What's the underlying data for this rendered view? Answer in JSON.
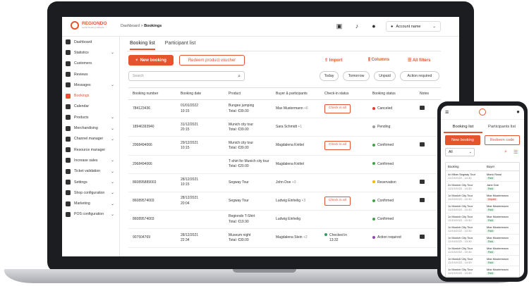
{
  "app": {
    "brand": "REGIONDO",
    "brand_sub": "tourist booking software"
  },
  "topbar": {
    "breadcrumb_parent": "Dashboard",
    "breadcrumb_sep": ">",
    "breadcrumb_current": "Bookings",
    "account_label": "Account name"
  },
  "sidebar": {
    "items": [
      {
        "label": "Dashboard",
        "icon": "grid-icon",
        "chevron": false
      },
      {
        "label": "Statistics",
        "icon": "chart-icon",
        "chevron": true
      },
      {
        "label": "Customers",
        "icon": "people-icon",
        "chevron": false
      },
      {
        "label": "Reviews",
        "icon": "star-icon",
        "chevron": false
      },
      {
        "label": "Messages",
        "icon": "mail-icon",
        "chevron": true
      },
      {
        "label": "Bookings",
        "icon": "ticket-icon",
        "chevron": false,
        "active": true
      },
      {
        "label": "Calendar",
        "icon": "calendar-icon",
        "chevron": false
      },
      {
        "label": "Products",
        "icon": "tag-icon",
        "chevron": true
      },
      {
        "label": "Merchandising",
        "icon": "bag-icon",
        "chevron": true
      },
      {
        "label": "Channel manager",
        "icon": "channel-icon",
        "chevron": true
      },
      {
        "label": "Resource manager",
        "icon": "resource-icon",
        "chevron": false
      },
      {
        "label": "Increase sales",
        "icon": "trend-icon",
        "chevron": true
      },
      {
        "label": "Ticket validation",
        "icon": "ticket-check-icon",
        "chevron": true
      },
      {
        "label": "Settings",
        "icon": "gear-icon",
        "chevron": true
      },
      {
        "label": "Shop configuration",
        "icon": "shop-icon",
        "chevron": true
      },
      {
        "label": "Marketing",
        "icon": "megaphone-icon",
        "chevron": true
      },
      {
        "label": "POS configuration",
        "icon": "pos-icon",
        "chevron": true
      }
    ]
  },
  "main": {
    "tabs": [
      "Booking list",
      "Participant list"
    ],
    "new_booking": "New booking",
    "redeem_voucher": "Redeem product voucher",
    "import": "Import",
    "columns": "Columns",
    "all_filters": "All filters",
    "search_placeholder": "Search",
    "filters": [
      "Today",
      "Tomorrow",
      "Unpaid",
      "Action required"
    ],
    "columns_headers": [
      "Booking number",
      "Booking date",
      "Product",
      "Buyer & participants",
      "Check-in status",
      "Booking status",
      "Notes"
    ],
    "rows": [
      {
        "num": "784123436",
        "date": "01/01/2022",
        "time": "10:15",
        "product": "Bungee jumping",
        "total": "Total: €39.00",
        "buyer": "Max Mustermann",
        "extra": "+6",
        "checkin": "Check in all",
        "status": "Canceled",
        "status_color": "#e53935",
        "note": true
      },
      {
        "num": "18946393940",
        "date": "31/12/2021",
        "time": "20:15",
        "product": "Munich city tour",
        "total": "Total: €39.00",
        "buyer": "Sara Schmidt",
        "extra": "+1",
        "checkin": "",
        "status": "Pending",
        "status_color": "#9e9e9e",
        "note": false
      },
      {
        "num": "2068494066",
        "date": "29/12/2021",
        "time": "10:15",
        "product": "Munich city tour",
        "total": "Total: €39.00",
        "buyer": "Magdalena Knittel",
        "extra": "",
        "checkin": "Check in all",
        "status": "Confirmed",
        "status_color": "#43a047",
        "note": true
      },
      {
        "num": "2068494066",
        "date": "",
        "time": "",
        "product": "T-shirt for Munich city tour",
        "total": "Total: €20.00",
        "buyer": "Magdalena Knittel",
        "extra": "",
        "checkin": "",
        "status": "Confirmed",
        "status_color": "#43a047",
        "note": false
      },
      {
        "num": "860895889003",
        "date": "28/12/2021",
        "time": "10:15",
        "product": "Segway Tour",
        "total": "",
        "buyer": "John Doe",
        "extra": "+3",
        "checkin": "",
        "status": "Reservation",
        "status_color": "#f2b705",
        "note": true
      },
      {
        "num": "86089574003",
        "date": "28/12/2021",
        "time": "20:04",
        "product": "Segway Tour",
        "total": "",
        "buyer": "Ludwig Einhelig",
        "extra": "+3",
        "checkin": "Check in all",
        "status": "Confirmed",
        "status_color": "#43a047",
        "note": true
      },
      {
        "num": "86089574003",
        "date": "",
        "time": "",
        "product": "Regiondo T-Shirt",
        "total": "Total: €19.90",
        "buyer": "Ludwig Einhelig",
        "extra": "",
        "checkin": "",
        "status": "Confirmed",
        "status_color": "#43a047",
        "note": false
      },
      {
        "num": "907504769",
        "date": "28/12/2021",
        "time": "22:34",
        "product": "Museum night",
        "total": "Total: €39.00",
        "buyer": "Magdalena Stein",
        "extra": "+2",
        "checkin": "Checked in",
        "checkin_time": "13:32",
        "status": "Action required",
        "status_color": "#8e44ad",
        "note": true
      }
    ]
  },
  "phone": {
    "tabs": [
      "Booking list",
      "Participants list"
    ],
    "new_booking": "New booking",
    "redeem_code": "Redeem code",
    "select_value": "All",
    "headers": [
      "Booking",
      "Buyer"
    ],
    "rows": [
      {
        "booking": "4x Milan Segway Tour",
        "date": "12/10/2022 - 10:30",
        "buyer": "Mario Rossi",
        "pay": "Paid"
      },
      {
        "booking": "2x Munich City Tour",
        "date": "12/10/2022 - 10:30",
        "buyer": "Jane Doe",
        "pay": "Paid"
      },
      {
        "booking": "1x Munich City Tour",
        "date": "12/10/2022 - 10:30",
        "buyer": "Max Mustermann",
        "pay": "Unpaid"
      },
      {
        "booking": "1x Munich City Tour",
        "date": "12/10/2022 - 10:30",
        "buyer": "Max Mustermann",
        "pay": "Paid"
      },
      {
        "booking": "1x Munich City Tour",
        "date": "12/10/2022 - 10:30",
        "buyer": "Max Mustermann",
        "pay": "Paid"
      },
      {
        "booking": "1x Munich City Tour",
        "date": "12/10/2022 - 10:30",
        "buyer": "Max Mustermann",
        "pay": "Paid"
      },
      {
        "booking": "1x Munich City Tour",
        "date": "12/10/2022 - 10:30",
        "buyer": "Max Mustermann",
        "pay": "Paid"
      },
      {
        "booking": "1x Munich City Tour",
        "date": "12/10/2022 - 10:30",
        "buyer": "Max Mustermann",
        "pay": "Paid"
      },
      {
        "booking": "1x Munich City Tour",
        "date": "12/10/2022 - 10:30",
        "buyer": "Max Mustermann",
        "pay": "Paid"
      },
      {
        "booking": "1x Munich City Tour",
        "date": "12/10/2022 - 10:30",
        "buyer": "Max Mustermann",
        "pay": "Paid"
      }
    ]
  },
  "colors": {
    "accent": "#e5542e",
    "paid": "#2e7d4f",
    "unpaid": "#c0392b"
  }
}
